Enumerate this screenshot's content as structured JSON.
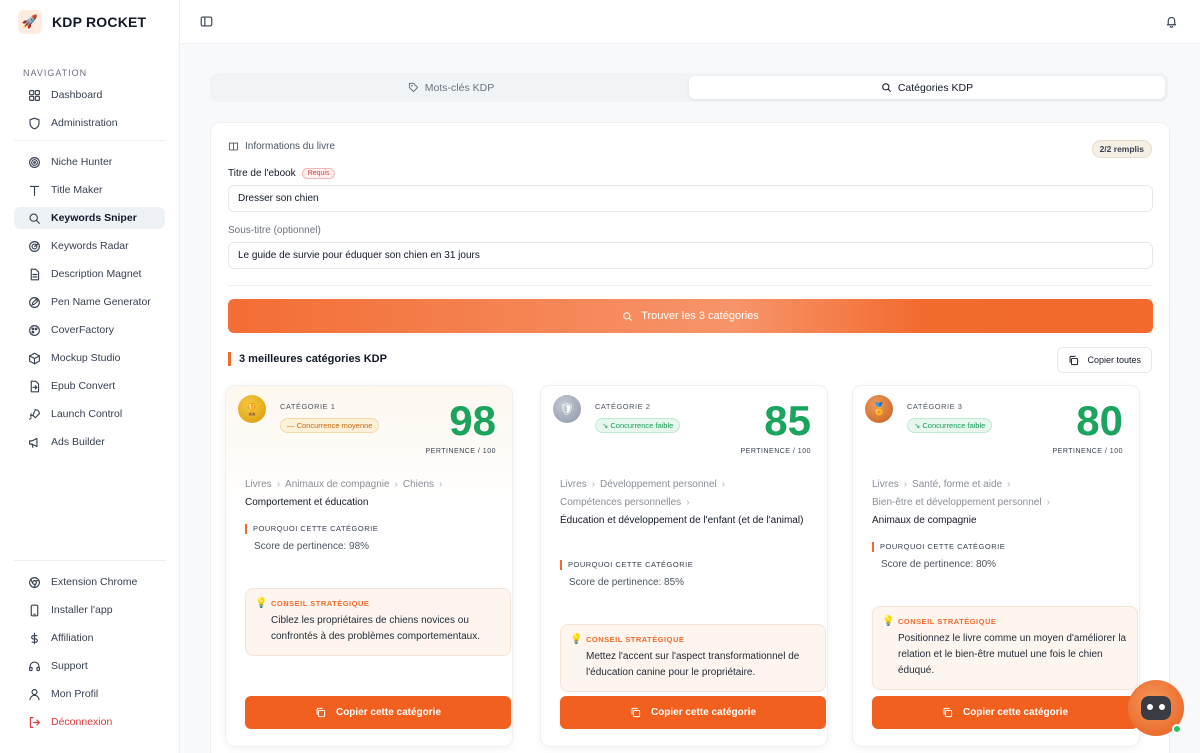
{
  "brand": {
    "name": "KDP ROCKET"
  },
  "sidebar": {
    "heading": "NAVIGATION",
    "group1": [
      {
        "label": "Dashboard",
        "icon": "dashboard-icon"
      },
      {
        "label": "Administration",
        "icon": "shield-icon"
      }
    ],
    "group2": [
      {
        "label": "Niche Hunter",
        "icon": "target-icon"
      },
      {
        "label": "Title Maker",
        "icon": "text-icon"
      },
      {
        "label": "Keywords Sniper",
        "icon": "search-icon",
        "active": true
      },
      {
        "label": "Keywords Radar",
        "icon": "radar-icon"
      },
      {
        "label": "Description Magnet",
        "icon": "document-icon"
      },
      {
        "label": "Pen Name Generator",
        "icon": "pen-icon"
      },
      {
        "label": "CoverFactory",
        "icon": "palette-icon"
      },
      {
        "label": "Mockup Studio",
        "icon": "cube-icon"
      },
      {
        "label": "Epub Convert",
        "icon": "file-convert-icon"
      },
      {
        "label": "Launch Control",
        "icon": "rocket-icon"
      },
      {
        "label": "Ads Builder",
        "icon": "megaphone-icon"
      }
    ],
    "group3": [
      {
        "label": "Extension Chrome",
        "icon": "chrome-icon"
      },
      {
        "label": "Installer l'app",
        "icon": "phone-icon"
      },
      {
        "label": "Affiliation",
        "icon": "dollar-icon"
      },
      {
        "label": "Support",
        "icon": "headset-icon"
      },
      {
        "label": "Mon Profil",
        "icon": "user-icon"
      },
      {
        "label": "Déconnexion",
        "icon": "logout-icon"
      }
    ]
  },
  "tabs": [
    {
      "label": "Mots-clés KDP",
      "active": false
    },
    {
      "label": "Catégories KDP",
      "active": true
    }
  ],
  "form": {
    "section_label": "Informations du livre",
    "filled_badge": "2/2 remplis",
    "title_label": "Titre de l'ebook",
    "required_badge": "Requis",
    "title_value": "Dresser son chien",
    "subtitle_label": "Sous-titre (optionnel)",
    "subtitle_value": "Le guide de survie pour éduquer son chien en 31 jours",
    "cta_label": "Trouver les 3 catégories"
  },
  "results": {
    "title": "3 meilleures catégories KDP",
    "copy_all": "Copier toutes",
    "score_sub": "PERTINENCE / 100",
    "why_title": "POURQUOI CETTE CATÉGORIE",
    "tip_title": "CONSEIL STRATÉGIQUE",
    "copy_label": "Copier cette catégorie",
    "cards": [
      {
        "label": "CATÉGORIE 1",
        "competition": "— Concurrence moyenne",
        "score": "98",
        "crumb_lines": [
          [
            "Livres",
            "Animaux de compagnie",
            "Chiens"
          ]
        ],
        "final": "Comportement et éducation",
        "why_text": "Score de pertinence: 98%",
        "tip_text": "Ciblez les propriétaires de chiens novices ou confrontés à des problèmes comportementaux."
      },
      {
        "label": "CATÉGORIE 2",
        "competition": "↘ Concurrence faible",
        "score": "85",
        "crumb_lines": [
          [
            "Livres",
            "Développement personnel"
          ],
          [
            "Compétences personnelles"
          ]
        ],
        "final": "Éducation et développement de l'enfant (et de l'animal)",
        "why_text": "Score de pertinence: 85%",
        "tip_text": "Mettez l'accent sur l'aspect transformationnel de l'éducation canine pour le propriétaire."
      },
      {
        "label": "CATÉGORIE 3",
        "competition": "↘ Concurrence faible",
        "score": "80",
        "crumb_lines": [
          [
            "Livres",
            "Santé, forme et aide"
          ],
          [
            "Bien-être et développement personnel"
          ]
        ],
        "final": "Animaux de compagnie",
        "why_text": "Score de pertinence: 80%",
        "tip_text": "Positionnez le livre comme un moyen d'améliorer la relation et le bien-être mutuel une fois le chien éduqué."
      }
    ]
  },
  "colors": {
    "accent": "#f26a2b",
    "score": "#1aa45d",
    "danger": "#e0393e"
  }
}
